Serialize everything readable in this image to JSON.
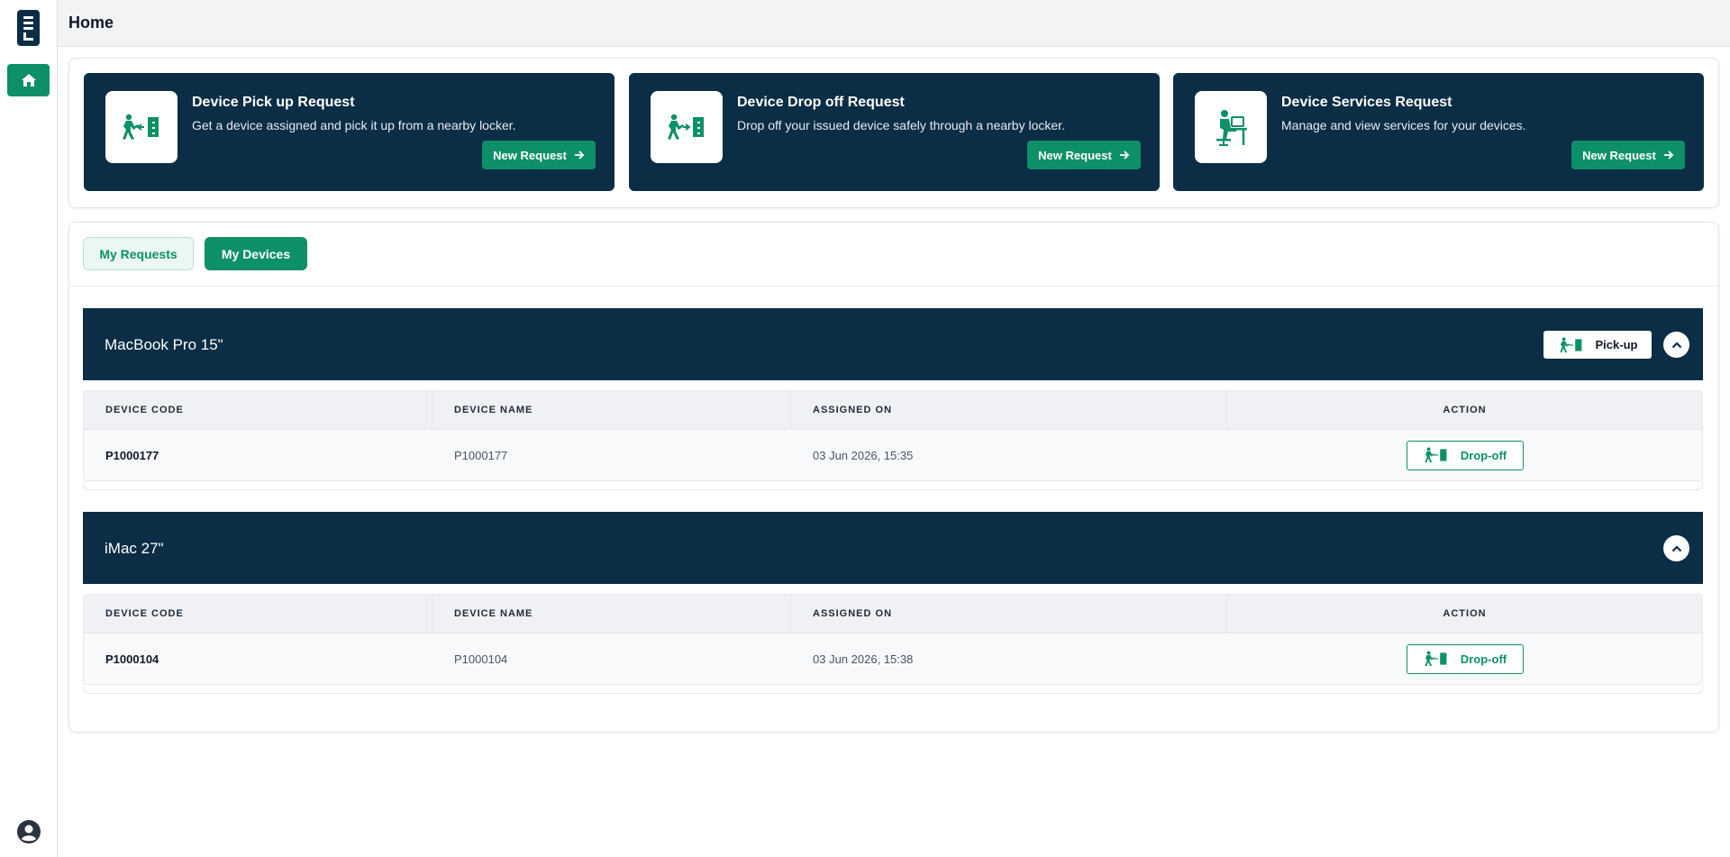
{
  "app": {
    "page_title": "Home"
  },
  "sidebar": {
    "items": [
      {
        "icon": "home-icon",
        "active": true
      }
    ],
    "bottom": {
      "icon": "user-avatar-icon"
    }
  },
  "request_cards": [
    {
      "title": "Device Pick up Request",
      "description": "Get a device assigned and pick it up from a nearby locker.",
      "button": "New Request",
      "icon": "device-pickup-icon"
    },
    {
      "title": "Device Drop off Request",
      "description": "Drop off your issued device safely through a nearby locker.",
      "button": "New Request",
      "icon": "device-dropoff-icon"
    },
    {
      "title": "Device Services Request",
      "description": "Manage and view services for your devices.",
      "button": "New Request",
      "icon": "device-services-icon"
    }
  ],
  "tabs": [
    {
      "label": "My Requests",
      "active": false
    },
    {
      "label": "My Devices",
      "active": true
    }
  ],
  "table_headers": [
    "DEVICE CODE",
    "DEVICE NAME",
    "ASSIGNED ON",
    "ACTION"
  ],
  "devices": [
    {
      "name": "MacBook Pro 15\"",
      "pickup_button": "Pick-up",
      "rows": [
        {
          "code": "P1000177",
          "device_name": "P1000177",
          "assigned_on": "03 Jun 2026, 15:35",
          "action": "Drop-off"
        }
      ]
    },
    {
      "name": "iMac 27\"",
      "rows": [
        {
          "code": "P1000104",
          "device_name": "P1000104",
          "assigned_on": "03 Jun 2026, 15:38",
          "action": "Drop-off"
        }
      ]
    }
  ],
  "colors": {
    "navy": "#0b2d45",
    "green": "#0d9068",
    "light_green": "#eaf7f2"
  }
}
